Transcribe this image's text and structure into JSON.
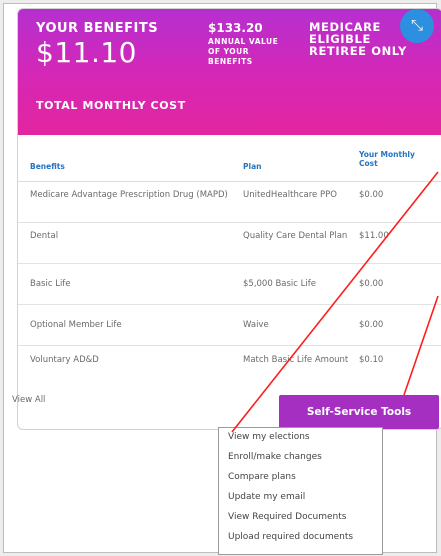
{
  "banner": {
    "your_benefits_label": "YOUR BENEFITS",
    "monthly_amount": "$11.10",
    "total_monthly_label": "TOTAL MONTHLY COST",
    "annual_value": "$133.20",
    "annual_value_caption": "ANNUAL VALUE OF YOUR BENEFITS",
    "eligibility": "MEDICARE ELIGIBLE RETIREE ONLY",
    "collapse_icon": "collapse-arrows-icon",
    "colors": {
      "gradient_top": "#b52fcf",
      "gradient_bottom": "#e3259f",
      "collapse_button": "#2d8fe0"
    }
  },
  "table": {
    "headers": [
      "Benefits",
      "Plan",
      "Your Monthly Cost"
    ],
    "rows": [
      {
        "benefit": "Medicare Advantage Prescription Drug (MAPD)",
        "plan": "UnitedHealthcare PPO",
        "cost": "$0.00"
      },
      {
        "benefit": "Dental",
        "plan": "Quality Care Dental Plan",
        "cost": "$11.00"
      },
      {
        "benefit": "Basic Life",
        "plan": "$5,000 Basic Life",
        "cost": "$0.00"
      },
      {
        "benefit": "Optional Member Life",
        "plan": "Waive",
        "cost": "$0.00"
      },
      {
        "benefit": "Voluntary AD&D",
        "plan": "Match Basic Life Amount",
        "cost": "$0.10"
      }
    ],
    "header_color": "#2474c3"
  },
  "view_all_label": "View All",
  "self_service": {
    "label": "Self-Service Tools",
    "color": "#a42fc0",
    "menu_items": [
      "View my elections",
      "Enroll/make changes",
      "Compare plans",
      "Update my email",
      "View Required Documents",
      "Upload required documents"
    ]
  },
  "annotation_color": "#ff1e1e"
}
